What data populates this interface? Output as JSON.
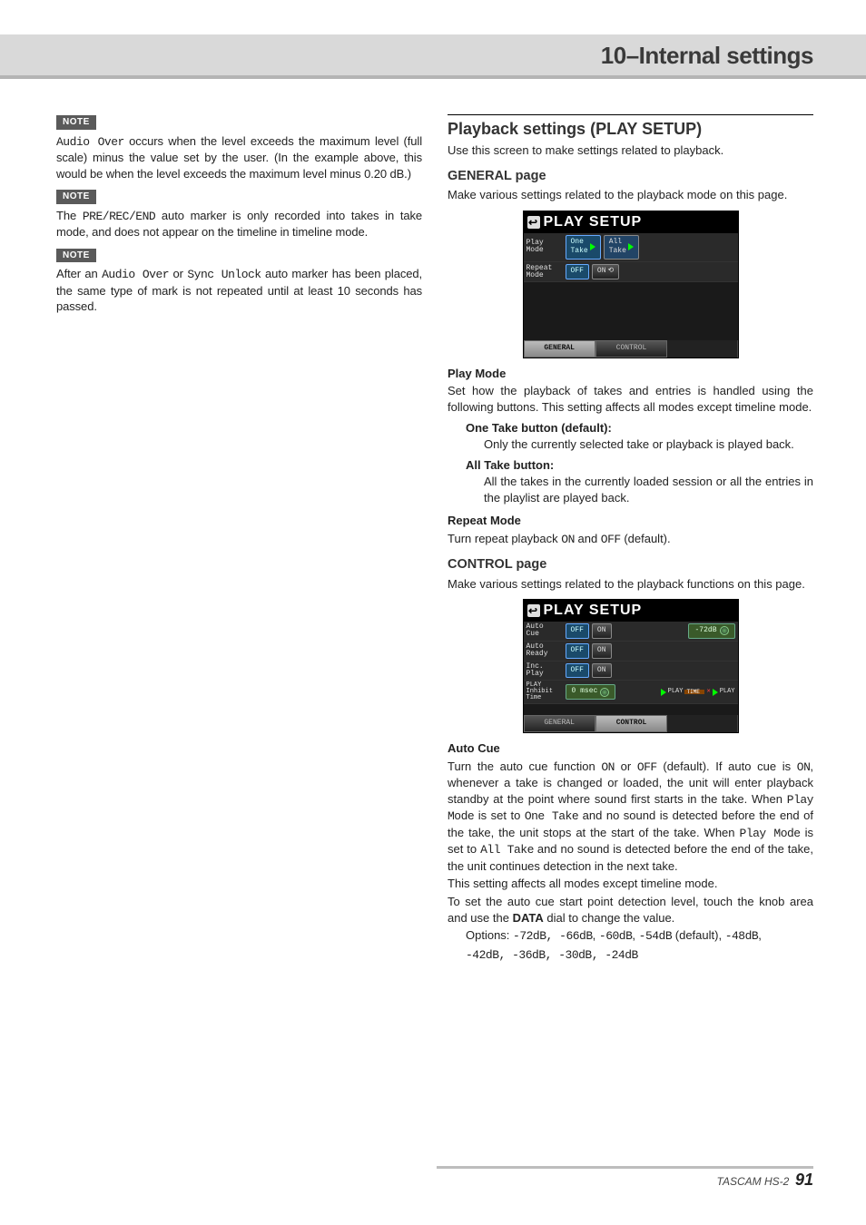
{
  "header": {
    "title": "10–Internal settings"
  },
  "left": {
    "note_label": "NOTE",
    "note1_a": "Audio Over",
    "note1_b": " occurs when the level exceeds the maximum level (full scale) minus the value set by the user. (In the example above, this would be when the level exceeds the maximum level minus 0.20 dB.)",
    "note2_a": "The ",
    "note2_b": "PRE/REC/END",
    "note2_c": " auto marker is only recorded into takes in take mode, and does not appear on the timeline in timeline mode.",
    "note3_a": "After an ",
    "note3_b": "Audio Over",
    "note3_c": " or ",
    "note3_d": "Sync Unlock",
    "note3_e": " auto marker has been placed, the same type of mark is not repeated until at least 10 seconds has passed."
  },
  "right": {
    "h2": "Playback settings (PLAY SETUP)",
    "intro": "Use this screen to make settings related to playback.",
    "general": {
      "h3": "GENERAL page",
      "desc": "Make various settings related to the playback mode on this page.",
      "screen": {
        "title": "PLAY SETUP",
        "row1_label": "Play\nMode",
        "row1_btn1": "One\nTake",
        "row1_btn2": "All\nTake",
        "row2_label": "Repeat\nMode",
        "row2_btn1": "OFF",
        "row2_btn2": "ON",
        "tab1": "GENERAL",
        "tab2": "CONTROL"
      },
      "playmode_h": "Play Mode",
      "playmode_desc": "Set how the playback of takes and entries is handled using the following buttons. This setting affects all modes except timeline mode.",
      "one_take_h": "One Take button (default):",
      "one_take_desc": "Only the currently selected take or playback is played back.",
      "all_take_h": "All Take button:",
      "all_take_desc": "All the takes in the currently loaded session or all the entries in the playlist are played back.",
      "repeat_h": "Repeat Mode",
      "repeat_a": "Turn repeat playback ",
      "repeat_on": "ON",
      "repeat_b": " and ",
      "repeat_off": "OFF",
      "repeat_c": " (default)."
    },
    "control": {
      "h3": "CONTROL page",
      "desc": "Make various settings related to the playback functions on this page.",
      "screen": {
        "title": "PLAY SETUP",
        "r1_label": "Auto\nCue",
        "r2_label": "Auto\nReady",
        "r3_label": "Inc.\nPlay",
        "r4_label": "PLAY\nInhibit\nTime",
        "off": "OFF",
        "on": "ON",
        "knob1": "-72dB",
        "knob2": "0 msec",
        "play_lbl": "PLAY",
        "tab1": "GENERAL",
        "tab2": "CONTROL"
      },
      "autocue_h": "Auto Cue",
      "ac_a": "Turn the auto cue function ",
      "ac_on": "ON",
      "ac_b": " or ",
      "ac_off": "OFF",
      "ac_c": " (default). If auto cue is ",
      "ac_on2": "ON",
      "ac_d": ", whenever a take is changed or loaded, the unit will enter playback standby at the point where sound first starts in the take. When ",
      "ac_pm": "Play Mode",
      "ac_e": " is set to ",
      "ac_ot": "One Take",
      "ac_f": " and no sound is detected before the end of the take, the unit stops at the start of the take. When ",
      "ac_pm2": "Play Mode",
      "ac_g": " is set to ",
      "ac_at": "All Take",
      "ac_h": " and no sound is detected before the end of the take, the unit continues detection in the next take.",
      "ac_i": "This setting affects all modes except timeline mode.",
      "ac_j": "To set the auto cue start point detection level, touch the knob area and use the ",
      "data_bold": "DATA",
      "ac_k": " dial to change the value.",
      "opts_label": "Options: ",
      "opts_a": "-72dB, -66dB",
      "opts_b": ", ",
      "opts_c": "-60dB",
      "opts_d": ", ",
      "opts_e": "-54dB",
      "opts_f": " (default), ",
      "opts_g": "-48dB",
      "opts_h": ", ",
      "opts_line2": "-42dB, -36dB, -30dB, -24dB"
    }
  },
  "footer": {
    "model": "TASCAM HS-2",
    "page": "91"
  }
}
